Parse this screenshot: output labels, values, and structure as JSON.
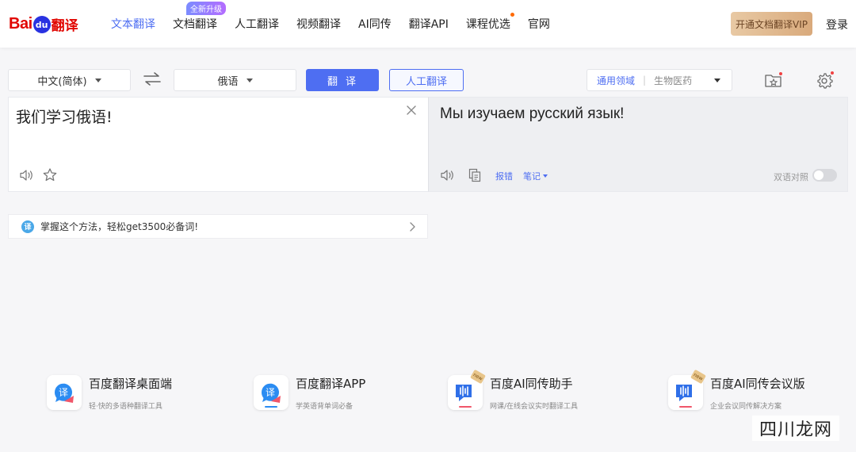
{
  "header": {
    "logo": {
      "bai": "Bai",
      "paw": "du",
      "fanyi": "翻译"
    },
    "nav": [
      {
        "label": "文本翻译",
        "active": true
      },
      {
        "label": "文档翻译",
        "badge": "全新升级"
      },
      {
        "label": "人工翻译"
      },
      {
        "label": "视频翻译"
      },
      {
        "label": "AI同传"
      },
      {
        "label": "翻译API"
      },
      {
        "label": "课程优选",
        "dot": true
      },
      {
        "label": "官网"
      }
    ],
    "vip_label": "开通文档翻译VIP",
    "login_label": "登录"
  },
  "toolbar": {
    "source_lang": "中文(简体)",
    "target_lang": "俄语",
    "translate_label": "翻译",
    "human_label": "人工翻译",
    "domain_primary": "通用领域",
    "domain_secondary": "生物医药"
  },
  "source": {
    "text": "我们学习俄语!"
  },
  "target": {
    "text": "Мы изучаем русский язык!",
    "report_label": "报错",
    "note_label": "笔记",
    "bilingual_label": "双语对照",
    "bilingual_on": false
  },
  "tip": {
    "icon_text": "译",
    "text": "掌握这个方法，轻松get3500必备词!"
  },
  "products": [
    {
      "title": "百度翻译桌面端",
      "desc": "轻·快的多语种翻译工具"
    },
    {
      "title": "百度翻译APP",
      "desc": "学英语背单词必备"
    },
    {
      "title": "百度AI同传助手",
      "desc": "网课/在线会议实时翻译工具",
      "badge": "new"
    },
    {
      "title": "百度AI同传会议版",
      "desc": "企业会议同传解决方案",
      "badge": "new"
    }
  ],
  "watermark": "四川龙网",
  "colors": {
    "accent": "#4e6ef2",
    "brand_red": "#e10601",
    "background": "#f6f6f8"
  }
}
